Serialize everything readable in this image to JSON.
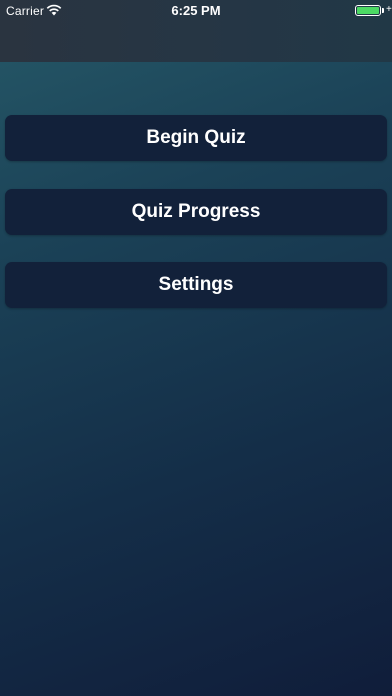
{
  "status_bar": {
    "carrier": "Carrier",
    "time": "6:25 PM",
    "wifi_icon": "wifi-icon",
    "battery_icon": "battery-icon",
    "charging_icon": "charging-bolt-icon",
    "charging_glyph": "+",
    "battery_level": 1.0,
    "battery_color": "#4cd964"
  },
  "menu": {
    "items": [
      {
        "label": "Begin Quiz"
      },
      {
        "label": "Quiz Progress"
      },
      {
        "label": "Settings"
      }
    ]
  },
  "colors": {
    "button_bg": "#12213a",
    "button_text": "#ffffff",
    "background_top": "#265968",
    "background_bottom": "#101d3a"
  }
}
